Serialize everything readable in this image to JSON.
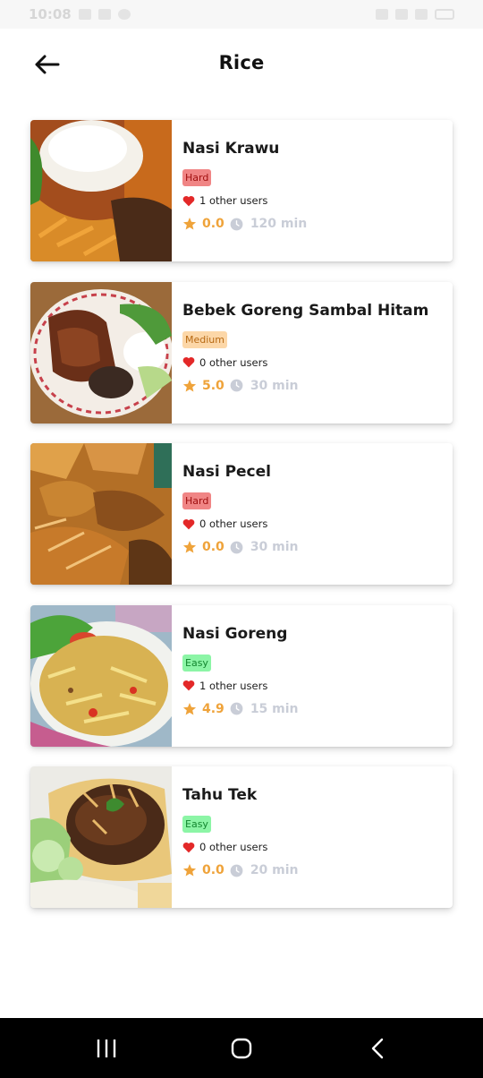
{
  "status_bar": {
    "time": "10:08"
  },
  "header": {
    "title": "Rice"
  },
  "recipes": [
    {
      "name": "Nasi Krawu",
      "difficulty": "Hard",
      "likes": "1 other users",
      "rating": "0.0",
      "time": "120 min"
    },
    {
      "name": "Bebek Goreng Sambal Hitam",
      "difficulty": "Medium",
      "likes": "0 other users",
      "rating": "5.0",
      "time": "30 min"
    },
    {
      "name": "Nasi Pecel",
      "difficulty": "Hard",
      "likes": "0 other users",
      "rating": "0.0",
      "time": "30 min"
    },
    {
      "name": "Nasi Goreng",
      "difficulty": "Easy",
      "likes": "1 other users",
      "rating": "4.9",
      "time": "15 min"
    },
    {
      "name": "Tahu Tek",
      "difficulty": "Easy",
      "likes": "0 other users",
      "rating": "0.0",
      "time": "20 min"
    }
  ],
  "colors": {
    "hard_badge": "#f08585",
    "medium_badge": "#fcd7a8",
    "easy_badge": "#8cf5a6",
    "heart": "#e32828",
    "star": "#efa33a",
    "clock": "#c9cdd7"
  },
  "icons": {
    "back": "arrow-left-icon",
    "like": "heart-icon",
    "rating": "star-icon",
    "duration": "clock-icon",
    "nav_recents": "recents-icon",
    "nav_home": "home-icon",
    "nav_back": "chevron-left-icon"
  }
}
